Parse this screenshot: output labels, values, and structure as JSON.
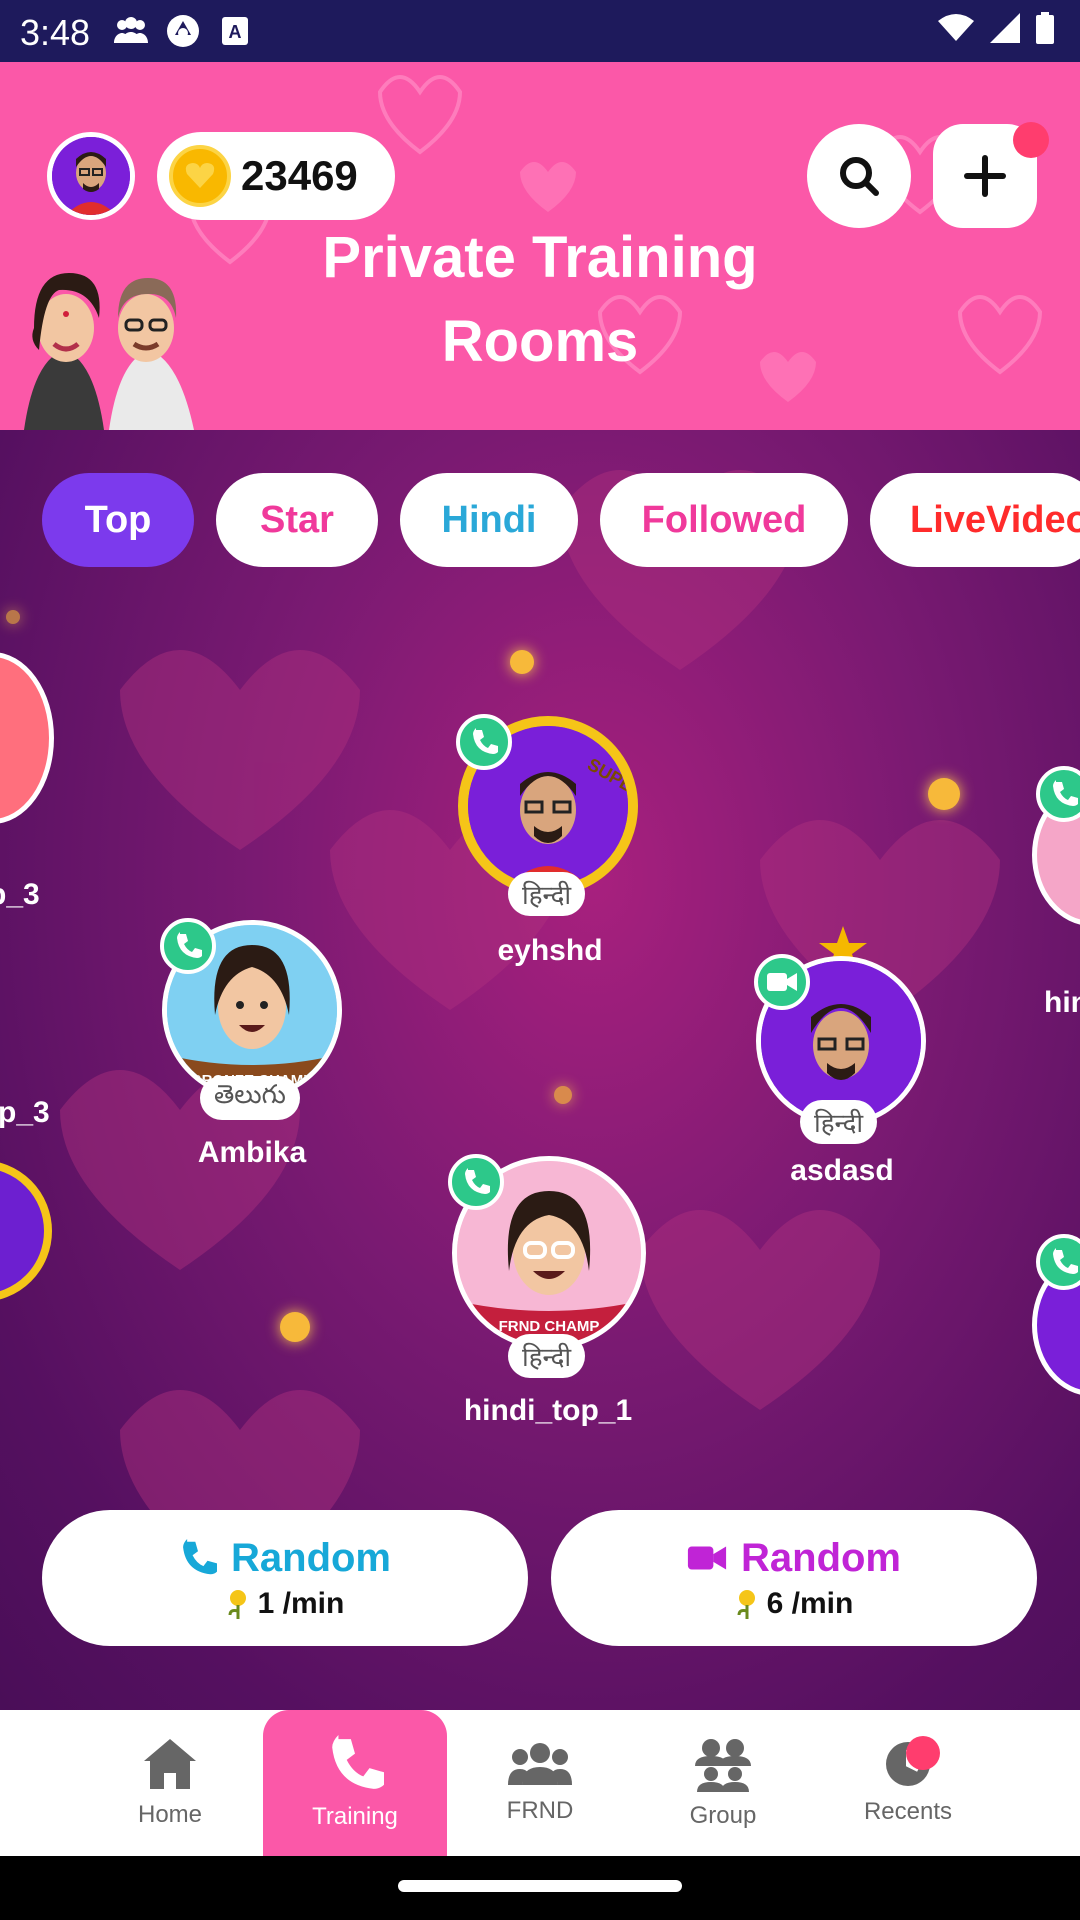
{
  "status_bar": {
    "time": "3:48"
  },
  "header": {
    "coins": "23469",
    "title_line1": "Private Training",
    "title_line2": "Rooms"
  },
  "filters": [
    {
      "label": "Top",
      "active": true
    },
    {
      "label": "Star"
    },
    {
      "label": "Hindi"
    },
    {
      "label": "Followed"
    },
    {
      "label": "LiveVideo"
    }
  ],
  "users": {
    "partial_left_top": {
      "name": "p_3"
    },
    "eyhshd": {
      "name": "eyhshd",
      "lang": "हिन्दी",
      "badge": "SUPER FRND",
      "call": "voice"
    },
    "ambika": {
      "name": "Ambika",
      "lang": "తెలుగు",
      "badge": "BRONZE CHAMP",
      "call": "voice"
    },
    "asdasd": {
      "name": "asdasd",
      "lang": "हिन्दी",
      "call": "video"
    },
    "hindi_top_1": {
      "name": "hindi_top_1",
      "lang": "हिन्दी",
      "badge": "FRND CHAMP",
      "call": "voice"
    },
    "partial_right": {
      "name": "hin"
    }
  },
  "random_buttons": [
    {
      "label": "Random",
      "rate": "1 /min",
      "type": "voice",
      "color": "#17a8d8"
    },
    {
      "label": "Random",
      "rate": "6 /min",
      "type": "video",
      "color": "#c024d6"
    }
  ],
  "bottom_nav": [
    {
      "label": "Home",
      "icon": "home-icon"
    },
    {
      "label": "Training",
      "icon": "phone-icon",
      "active": true
    },
    {
      "label": "FRND",
      "icon": "friends-icon"
    },
    {
      "label": "Group",
      "icon": "group-icon"
    },
    {
      "label": "Recents",
      "icon": "clock-icon",
      "badge_dot": true
    }
  ],
  "colors": {
    "header_pink": "#fb58a8",
    "active_chip": "#7c3aed",
    "status_bar": "#1e1a5c"
  }
}
